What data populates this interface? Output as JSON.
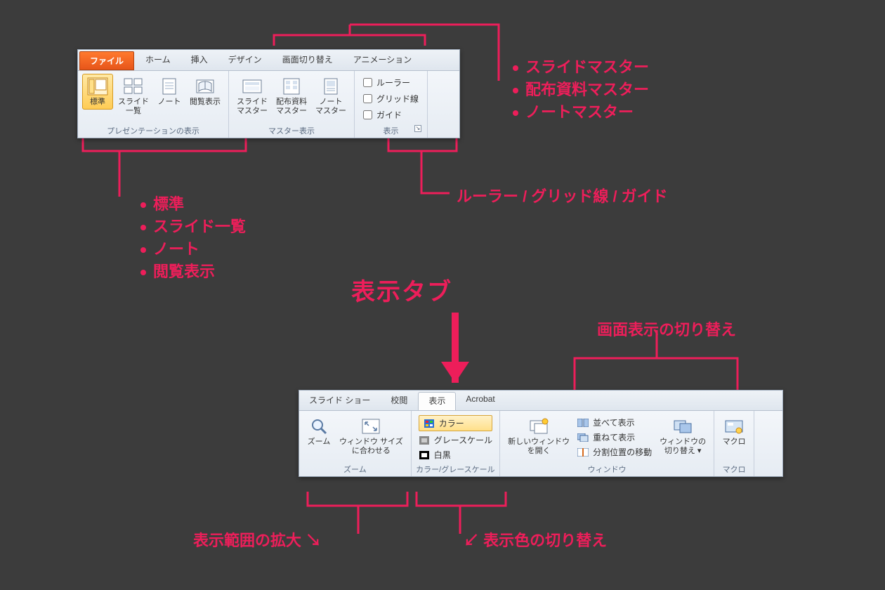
{
  "title": "表示タブ",
  "colors": {
    "accent": "#ed1e5a",
    "bg": "#3c3c3c",
    "file_tab_bg": "#ed6a1f"
  },
  "ribbon1": {
    "tabs": {
      "file": "ファイル",
      "home": "ホーム",
      "insert": "挿入",
      "design": "デザイン",
      "transition": "画面切り替え",
      "animation": "アニメーション"
    },
    "group_presentation": {
      "label": "プレゼンテーションの表示",
      "buttons": {
        "normal": "標準",
        "sorter": "スライド\n一覧",
        "notes": "ノート",
        "reading": "閲覧表示"
      }
    },
    "group_master": {
      "label": "マスター表示",
      "buttons": {
        "slide_master": "スライド\nマスター",
        "handout_master": "配布資料\nマスター",
        "notes_master": "ノート\nマスター"
      }
    },
    "group_show": {
      "label": "表示",
      "checks": {
        "ruler": "ルーラー",
        "grid": "グリッド線",
        "guide": "ガイド"
      }
    }
  },
  "ribbon2": {
    "tabs": {
      "slideshow": "スライド ショー",
      "review": "校閲",
      "view": "表示",
      "acrobat": "Acrobat"
    },
    "group_zoom": {
      "label": "ズーム",
      "buttons": {
        "zoom": "ズーム",
        "fit": "ウィンドウ サイズ\nに合わせる"
      }
    },
    "group_color": {
      "label": "カラー/グレースケール",
      "items": {
        "color": "カラー",
        "gray": "グレースケール",
        "bw": "白黒"
      }
    },
    "group_window": {
      "label": "ウィンドウ",
      "new_window": "新しいウィンドウ\nを開く",
      "arrange": "並べて表示",
      "cascade": "重ねて表示",
      "split": "分割位置の移動",
      "switch": "ウィンドウの\n切り替え ▾"
    },
    "group_macro": {
      "label": "マクロ",
      "button": "マクロ"
    }
  },
  "callouts": {
    "masters": [
      "スライドマスター",
      "配布資料マスター",
      "ノートマスター"
    ],
    "views": [
      "標準",
      "スライド一覧",
      "ノート",
      "閲覧表示"
    ],
    "show_items": "ルーラー / グリッド線 / ガイド",
    "switch": "画面表示の切り替え",
    "zoom": "表示範囲の拡大",
    "color_switch": "表示色の切り替え"
  }
}
